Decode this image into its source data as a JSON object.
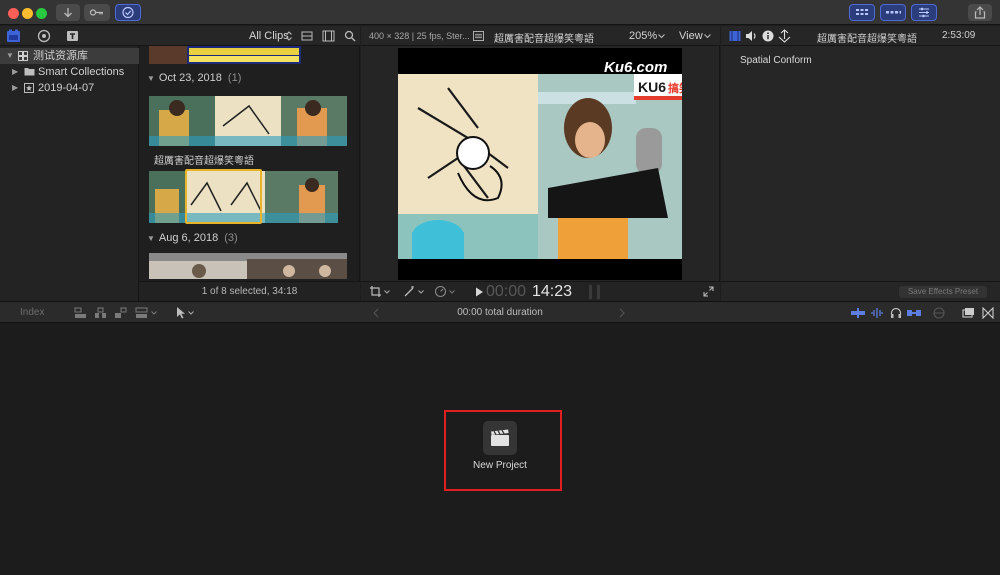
{
  "titlebar": {
    "buttons": [
      "import-arrow-icon",
      "key-icon",
      "background-tasks-icon"
    ],
    "right_buttons": [
      "workspace-browser-icon",
      "workspace-timeline-icon",
      "workspace-inspector-icon",
      "share-icon"
    ]
  },
  "browser": {
    "filter_label": "All Clips",
    "selection_status": "1 of 8 selected, 34:18"
  },
  "library": {
    "items": [
      {
        "label": "测试资源库",
        "expanded": true,
        "selected": true
      },
      {
        "label": "Smart Collections",
        "expanded": false
      },
      {
        "label": "2019-04-07",
        "expanded": false
      }
    ]
  },
  "clips": {
    "events": [
      {
        "date": "Oct 23, 2018",
        "count": "(1)",
        "clip_name": "超厲害配音超爆笑粵語"
      },
      {
        "date": "Aug 6, 2018",
        "count": "(3)"
      }
    ]
  },
  "viewer": {
    "format_info": "400 × 328 | 25 fps, Ster...",
    "clip_title": "超厲害配音超爆笑粵語",
    "zoom": "205%",
    "view_label": "View",
    "timecode_dim": "00:00",
    "timecode_bright": "14:23",
    "watermark": "Ku6.com",
    "watermark_badge": "KU6",
    "watermark_badge_extra": "搞笑"
  },
  "inspector": {
    "clip_title": "超厲害配音超爆笑粵語",
    "duration": "2:53:09",
    "section_label": "Spatial Conform",
    "save_preset_label": "Save Effects Preset"
  },
  "timeline": {
    "index_label": "Index",
    "duration_label": "00:00 total duration",
    "new_project_label": "New Project"
  },
  "colors": {
    "accent": "#4d6ad6",
    "highlight_border": "#e02020",
    "selection_yellow": "#e8b52a"
  }
}
